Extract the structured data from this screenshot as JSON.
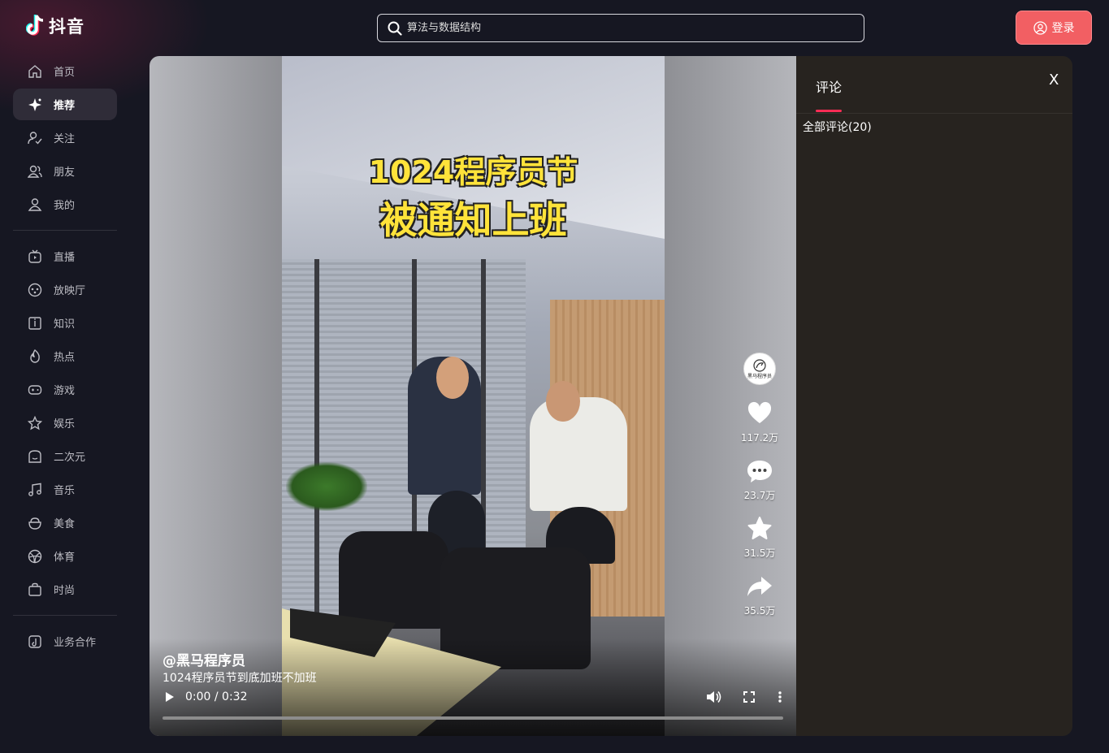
{
  "app": {
    "name": "抖音"
  },
  "search": {
    "placeholder": "算法与数据结构"
  },
  "header": {
    "login_label": "登录"
  },
  "sidebar": {
    "group1": [
      {
        "label": "首页",
        "icon": "home-icon"
      },
      {
        "label": "推荐",
        "icon": "sparkle-icon",
        "active": true
      },
      {
        "label": "关注",
        "icon": "follow-icon"
      },
      {
        "label": "朋友",
        "icon": "friends-icon"
      },
      {
        "label": "我的",
        "icon": "profile-icon"
      }
    ],
    "group2": [
      {
        "label": "直播",
        "icon": "tv-icon"
      },
      {
        "label": "放映厅",
        "icon": "cinema-icon"
      },
      {
        "label": "知识",
        "icon": "book-icon"
      },
      {
        "label": "热点",
        "icon": "flame-icon"
      },
      {
        "label": "游戏",
        "icon": "gamepad-icon"
      },
      {
        "label": "娱乐",
        "icon": "star-icon"
      },
      {
        "label": "二次元",
        "icon": "anime-icon"
      },
      {
        "label": "音乐",
        "icon": "music-icon"
      },
      {
        "label": "美食",
        "icon": "food-icon"
      },
      {
        "label": "体育",
        "icon": "ball-icon"
      },
      {
        "label": "时尚",
        "icon": "bag-icon"
      }
    ],
    "group3": [
      {
        "label": "业务合作",
        "icon": "business-icon"
      }
    ]
  },
  "video": {
    "overlay_line1": "1024程序员节",
    "overlay_line2": "被通知上班",
    "author": "@黑马程序员",
    "description": "1024程序员节到底加班不加班",
    "time": "0:00 / 0:32",
    "progress": 0,
    "avatar_text": "黑马程序员",
    "actions": {
      "likes": "117.2万",
      "comments": "23.7万",
      "favorites": "31.5万",
      "shares": "35.5万"
    }
  },
  "comments": {
    "tab_label": "评论",
    "close_label": "X",
    "count_label": "全部评论(20)"
  },
  "colors": {
    "accent": "#fe2c55",
    "login_button": "#f25f63",
    "background": "#161722",
    "comments_panel": "#27231f"
  }
}
